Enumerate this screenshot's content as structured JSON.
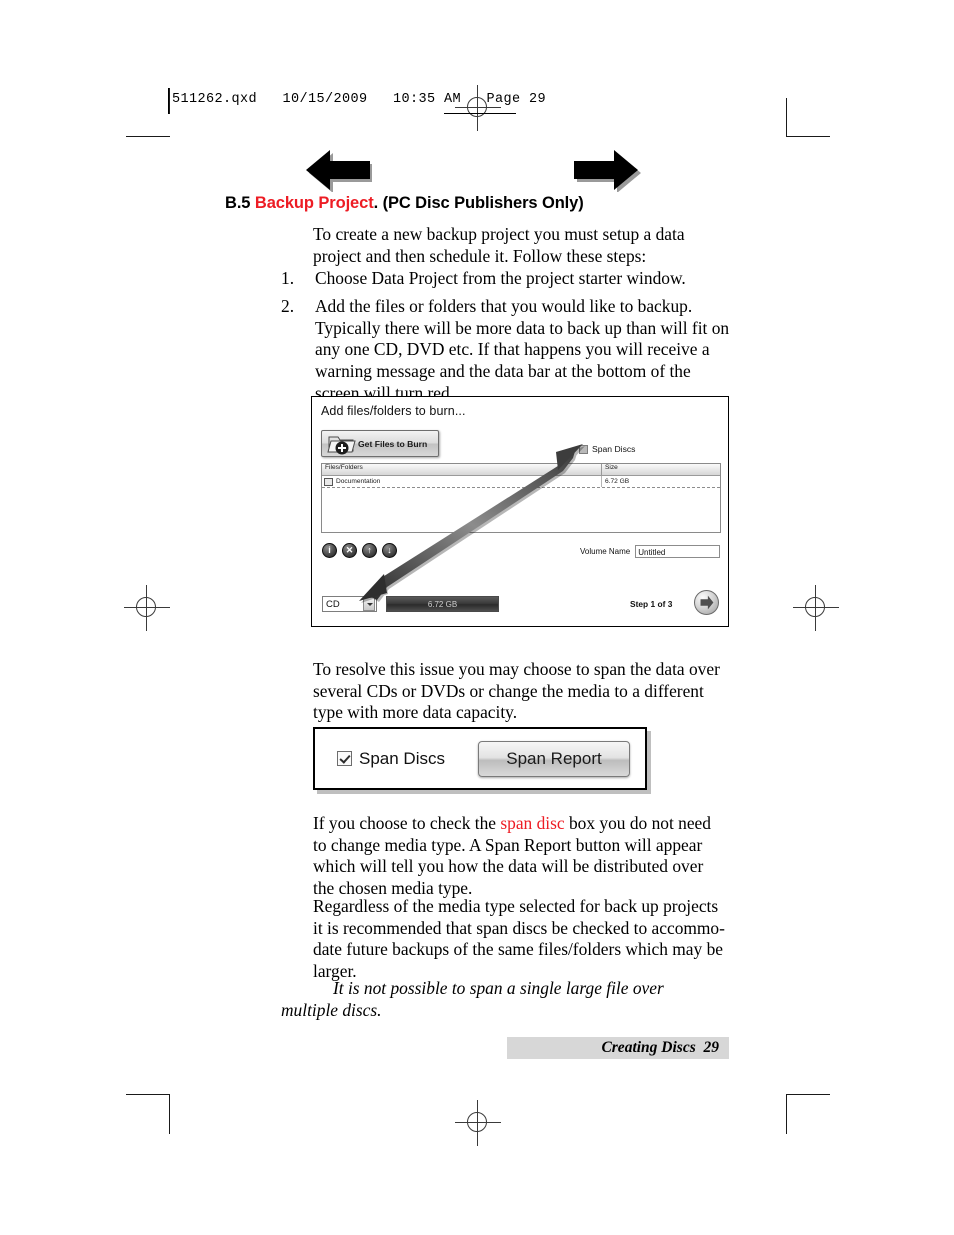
{
  "page": {
    "slug": "511262.qxd   10/15/2009   10:35 AM   Page 29",
    "footer_text": "Creating Discs  29"
  },
  "section": {
    "number": "B.5 ",
    "title_red": "Backup Project",
    "title_rest": ". (PC Disc Publishers Only)"
  },
  "body": {
    "intro": "To create a new backup project you must setup a data project and then schedule it.  Follow these steps:",
    "steps": [
      {
        "num": "1.",
        "text": "Choose Data Project from the project starter window."
      },
      {
        "num": "2.",
        "text": "Add the files or folders that you would like to backup. Typically there will be more data to back up than will fit on any one CD, DVD etc.  If that happens you will receive a warning message and the data bar at the bottom of the screen will turn red."
      }
    ],
    "resolve": "To resolve this issue you may choose to span the data over several CDs or DVDs or change the media to a different type with more data capacity.",
    "check_before": "If you choose to check the ",
    "check_red": "span disc",
    "check_after": " box you do not need to change media type.  A Span Report button will appear which will tell you how the data will be distributed over the chosen media type.",
    "regardless": "Regardless of the media type selected for back up projects it is recommended that span discs be checked to accommo-date future backups of the same files/folders which may be larger.",
    "note": "It is not possible to span a single large file over multiple discs."
  },
  "figure_dialog": {
    "title": "Add files/folders to burn...",
    "get_files_button": "Get Files to Burn",
    "span_discs_label": "Span Discs",
    "span_discs_checked": false,
    "table": {
      "headers": [
        "Files/Folders",
        "Size"
      ],
      "rows": [
        {
          "name": "Documentation",
          "size": "6.72 GB"
        }
      ]
    },
    "icon_buttons": [
      {
        "name": "info-button",
        "glyph": "i"
      },
      {
        "name": "delete-button",
        "glyph": "✕"
      },
      {
        "name": "move-up-button",
        "glyph": "↑"
      },
      {
        "name": "move-down-button",
        "glyph": "↓"
      }
    ],
    "volume_name_label": "Volume Name",
    "volume_name_value": "Untitled",
    "media_type_value": "CD",
    "data_bar_value": "6.72 GB",
    "step_label": "Step 1 of 3"
  },
  "figure_span": {
    "span_discs_label": "Span Discs",
    "span_discs_checked": true,
    "span_report_button": "Span Report"
  },
  "colors": {
    "accent_red": "#ed1c24",
    "footer_bar": "#d7d7d7"
  }
}
